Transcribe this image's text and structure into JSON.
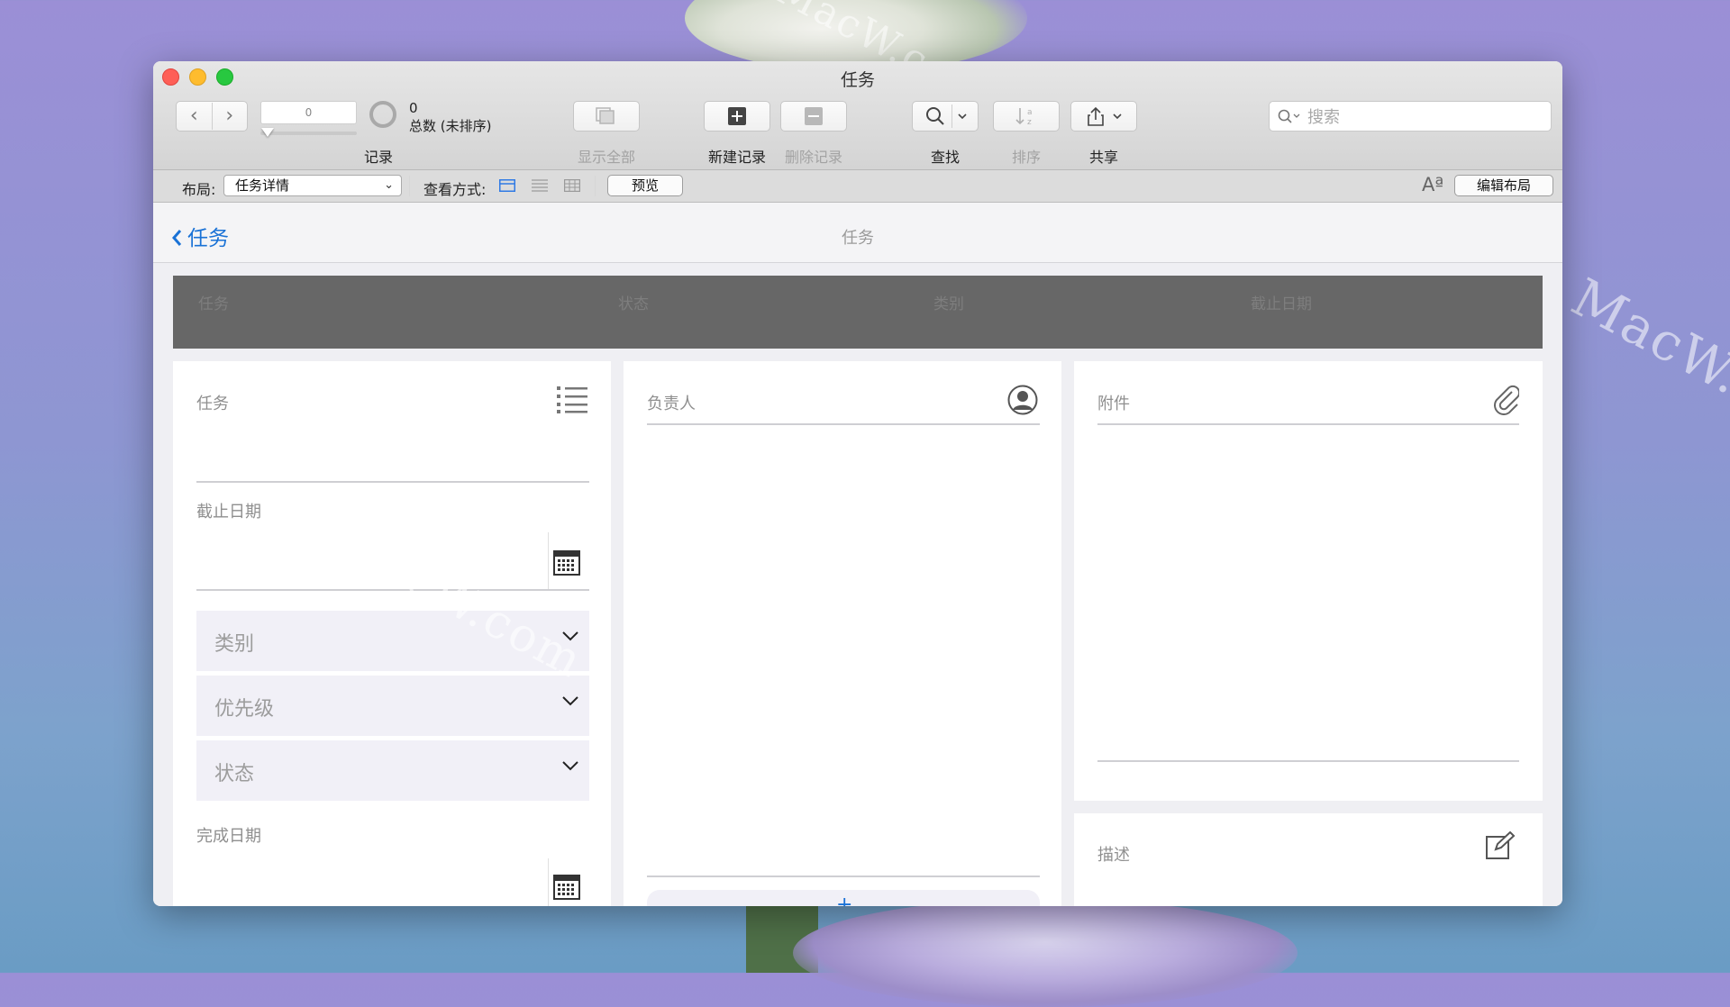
{
  "window": {
    "title": "任务"
  },
  "toolbar": {
    "record_value": "0",
    "records_label": "记录",
    "count_value": "0",
    "count_caption": "总数 (未排序)",
    "show_all_label": "显示全部",
    "new_record_label": "新建记录",
    "delete_record_label": "删除记录",
    "find_label": "查找",
    "sort_label": "排序",
    "share_label": "共享",
    "search_placeholder": "搜索"
  },
  "layout_bar": {
    "layout_label": "布局:",
    "layout_value": "任务详情",
    "view_as_label": "查看方式:",
    "preview_label": "预览",
    "edit_layout_label": "编辑布局",
    "font_icon_text": "Aª"
  },
  "nav": {
    "back_label": "任务",
    "title": "任务"
  },
  "list_header": {
    "columns": [
      "任务",
      "状态",
      "类别",
      "截止日期"
    ]
  },
  "form": {
    "task_label": "任务",
    "due_date_label": "截止日期",
    "category_label": "类别",
    "priority_label": "优先级",
    "status_label": "状态",
    "completed_date_label": "完成日期",
    "assignee_label": "负责人",
    "attachments_label": "附件",
    "description_label": "描述"
  },
  "watermark": "MacW.com",
  "colors": {
    "accent": "#1a72d6",
    "header_bg": "#676767",
    "dropdown_bg": "#f1f0f7"
  }
}
